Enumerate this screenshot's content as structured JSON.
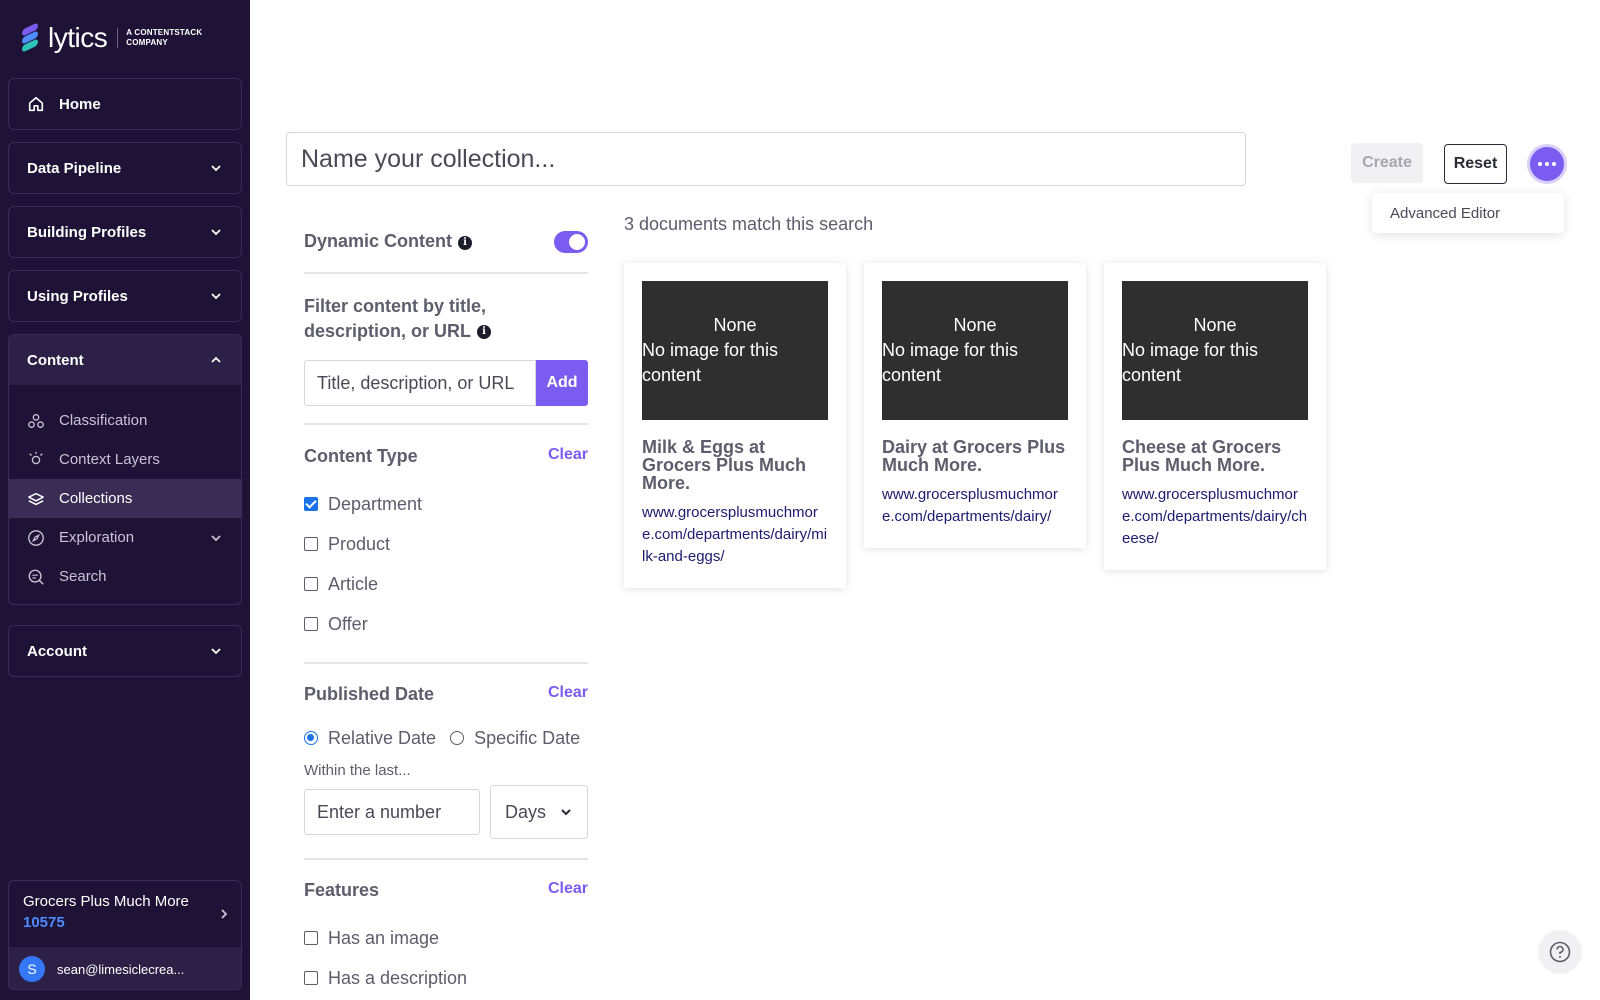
{
  "brand": {
    "name": "lytics",
    "sub": "A CONTENTSTACK COMPANY",
    "colors": [
      "#7b5cf0",
      "#4f8cff",
      "#2ec4b6"
    ]
  },
  "sidebar": {
    "home": "Home",
    "sections": [
      {
        "label": "Data Pipeline"
      },
      {
        "label": "Building Profiles"
      },
      {
        "label": "Using Profiles"
      }
    ],
    "content": {
      "label": "Content",
      "items": [
        {
          "label": "Classification",
          "icon": "classification-icon"
        },
        {
          "label": "Context Layers",
          "icon": "context-layers-icon"
        },
        {
          "label": "Collections",
          "icon": "collections-icon",
          "active": true
        },
        {
          "label": "Exploration",
          "icon": "exploration-icon"
        },
        {
          "label": "Search",
          "icon": "search-icon"
        }
      ]
    },
    "account": "Account",
    "account_panel": {
      "name": "Grocers Plus Much More",
      "id": "10575",
      "user_initial": "S",
      "user_email": "sean@limesiclecrea..."
    }
  },
  "header": {
    "name_placeholder": "Name your collection...",
    "create_label": "Create",
    "reset_label": "Reset",
    "menu": {
      "advanced_editor": "Advanced Editor"
    }
  },
  "filters": {
    "dynamic_content": {
      "label": "Dynamic Content",
      "enabled": true
    },
    "text_filter": {
      "label": "Filter content by title, description, or URL",
      "placeholder": "Title, description, or URL",
      "add_label": "Add"
    },
    "content_type": {
      "label": "Content Type",
      "clear": "Clear",
      "options": [
        {
          "label": "Department",
          "checked": true
        },
        {
          "label": "Product",
          "checked": false
        },
        {
          "label": "Article",
          "checked": false
        },
        {
          "label": "Offer",
          "checked": false
        }
      ]
    },
    "published_date": {
      "label": "Published Date",
      "clear": "Clear",
      "relative": "Relative Date",
      "specific": "Specific Date",
      "within_label": "Within the last...",
      "number_placeholder": "Enter a number",
      "unit": "Days"
    },
    "features": {
      "label": "Features",
      "clear": "Clear",
      "options": [
        {
          "label": "Has an image",
          "checked": false
        },
        {
          "label": "Has a description",
          "checked": false
        }
      ]
    }
  },
  "results": {
    "count_text": "3 documents match this search",
    "cards": [
      {
        "img_top": "None",
        "img_msg": "No image for this content",
        "title": "Milk & Eggs at Grocers Plus Much More.",
        "url": "www.grocersplusmuchmore.com/departments/dairy/milk-and-eggs/"
      },
      {
        "img_top": "None",
        "img_msg": "No image for this content",
        "title": "Dairy at Grocers Plus Much More.",
        "url": "www.grocersplusmuchmore.com/departments/dairy/"
      },
      {
        "img_top": "None",
        "img_msg": "No image for this content",
        "title": "Cheese at Grocers Plus Much More.",
        "url": "www.grocersplusmuchmore.com/departments/dairy/cheese/"
      }
    ]
  }
}
